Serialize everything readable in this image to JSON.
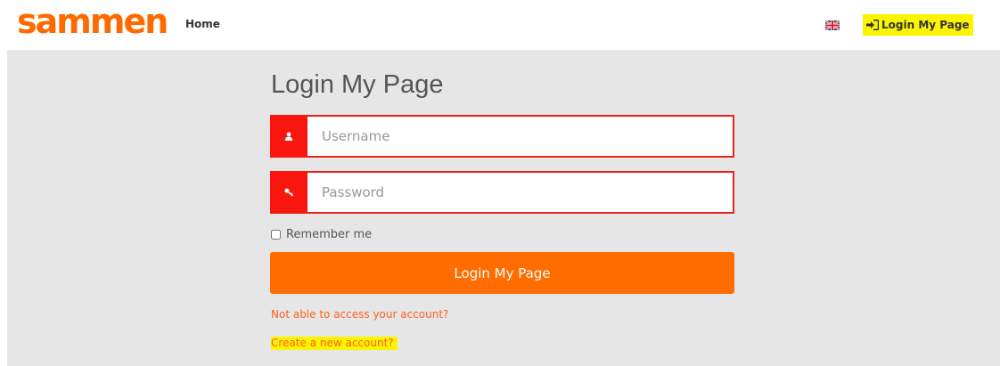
{
  "header": {
    "logo_text": "sammen",
    "nav_home": "Home",
    "language_icon": "uk-flag-icon",
    "login_link": "Login My Page",
    "login_icon": "sign-in-icon"
  },
  "login_form": {
    "title": "Login My Page",
    "username": {
      "placeholder": "Username",
      "value": "",
      "icon": "user-icon"
    },
    "password": {
      "placeholder": "Password",
      "value": "",
      "icon": "key-icon"
    },
    "remember_label": "Remember me",
    "remember_checked": false,
    "submit_label": "Login My Page",
    "forgot_link": "Not able to access your account?",
    "create_link": "Create a new account?"
  },
  "colors": {
    "brand_orange": "#ff6c00",
    "input_red": "#f8160f",
    "highlight_yellow": "#fbf400",
    "content_bg": "#e6e6e6"
  }
}
